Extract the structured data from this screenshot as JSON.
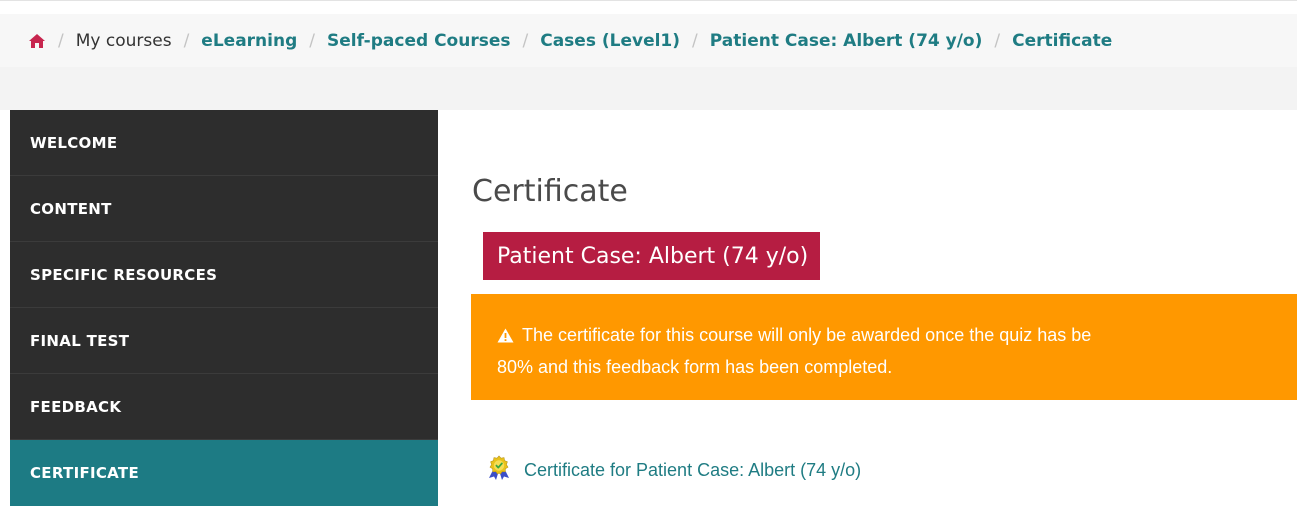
{
  "breadcrumb": {
    "home_icon": "home-icon",
    "separator": "/",
    "items": [
      {
        "label": "My courses",
        "link": false
      },
      {
        "label": "eLearning",
        "link": true
      },
      {
        "label": "Self-paced Courses",
        "link": true
      },
      {
        "label": "Cases (Level1)",
        "link": true
      },
      {
        "label": "Patient Case: Albert (74 y/o)",
        "link": true
      },
      {
        "label": "Certificate",
        "link": true
      }
    ]
  },
  "sidebar": {
    "items": [
      {
        "label": "WELCOME",
        "active": false
      },
      {
        "label": "CONTENT",
        "active": false
      },
      {
        "label": "SPECIFIC RESOURCES",
        "active": false
      },
      {
        "label": "FINAL TEST",
        "active": false
      },
      {
        "label": "FEEDBACK",
        "active": false
      },
      {
        "label": "CERTIFICATE",
        "active": true
      }
    ]
  },
  "main": {
    "title": "Certificate",
    "course_badge": "Patient Case: Albert (74 y/o)",
    "alert": {
      "icon": "warning-icon",
      "line1": "The certificate for this course will only be awarded once the quiz has be",
      "line2": "80% and this feedback form has been completed."
    },
    "certificate_link": {
      "icon": "award-icon",
      "label": "Certificate for Patient Case: Albert (74 y/o)"
    }
  },
  "colors": {
    "link": "#1f7c83",
    "sidebar_bg": "#2d2d2d",
    "active_nav": "#1d7b84",
    "badge": "#b61d42",
    "alert": "#ff9800",
    "home_icon": "#c7254e"
  }
}
